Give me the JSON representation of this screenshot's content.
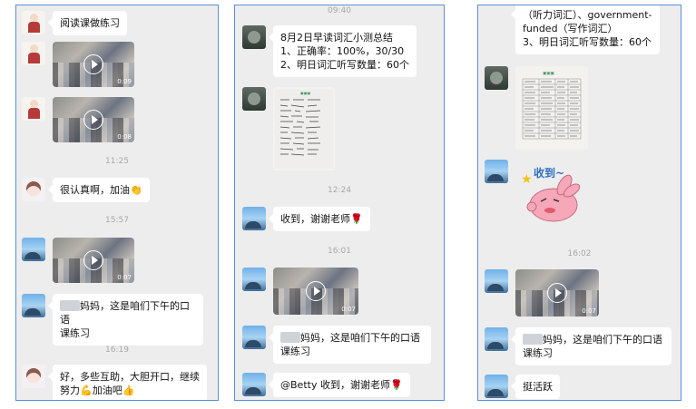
{
  "panel1": {
    "msg_read": "阅读课做练习",
    "video1_duration": "0:09",
    "video2_duration": "0:08",
    "time1": "11:25",
    "msg_serious": "很认真啊，加油👏",
    "time2": "15:57",
    "video3_duration": "0:07",
    "msg_oral_part1": "妈妈，这是咱们下午的口语",
    "msg_oral_part2": "课练习",
    "time3": "16:19",
    "msg_help": "好，多些互助，大胆开口，继续\n努力💪加油吧👍"
  },
  "panel2": {
    "time_top": "09:40",
    "msg_summary": "8月2日早读词汇小测总结\n1、正确率：100%，30/30\n2、明日词汇听写数量：60个",
    "time1": "12:24",
    "msg_thanks": "收到，谢谢老师🌹",
    "time2": "16:01",
    "video_duration": "0:07",
    "msg_oral_part1": "妈妈，这是咱们下午的口语",
    "msg_oral_part2": "课练习",
    "msg_betty": "@Betty 收到，谢谢老师🌹"
  },
  "panel3": {
    "msg_vocab": "（听力词汇）、government-\nfunded（写作词汇）\n3、明日词汇听写数量：60个",
    "sticker_text": "收到~",
    "time1": "16:02",
    "video_duration": "0:07",
    "msg_oral_part1": "妈妈，这是咱们下午的口语",
    "msg_oral_part2": "课练习",
    "msg_active": "挺活跃"
  },
  "colors": {
    "panel_bg": "#ededed",
    "panel_border": "#5b8fd6",
    "bubble": "#ffffff"
  }
}
